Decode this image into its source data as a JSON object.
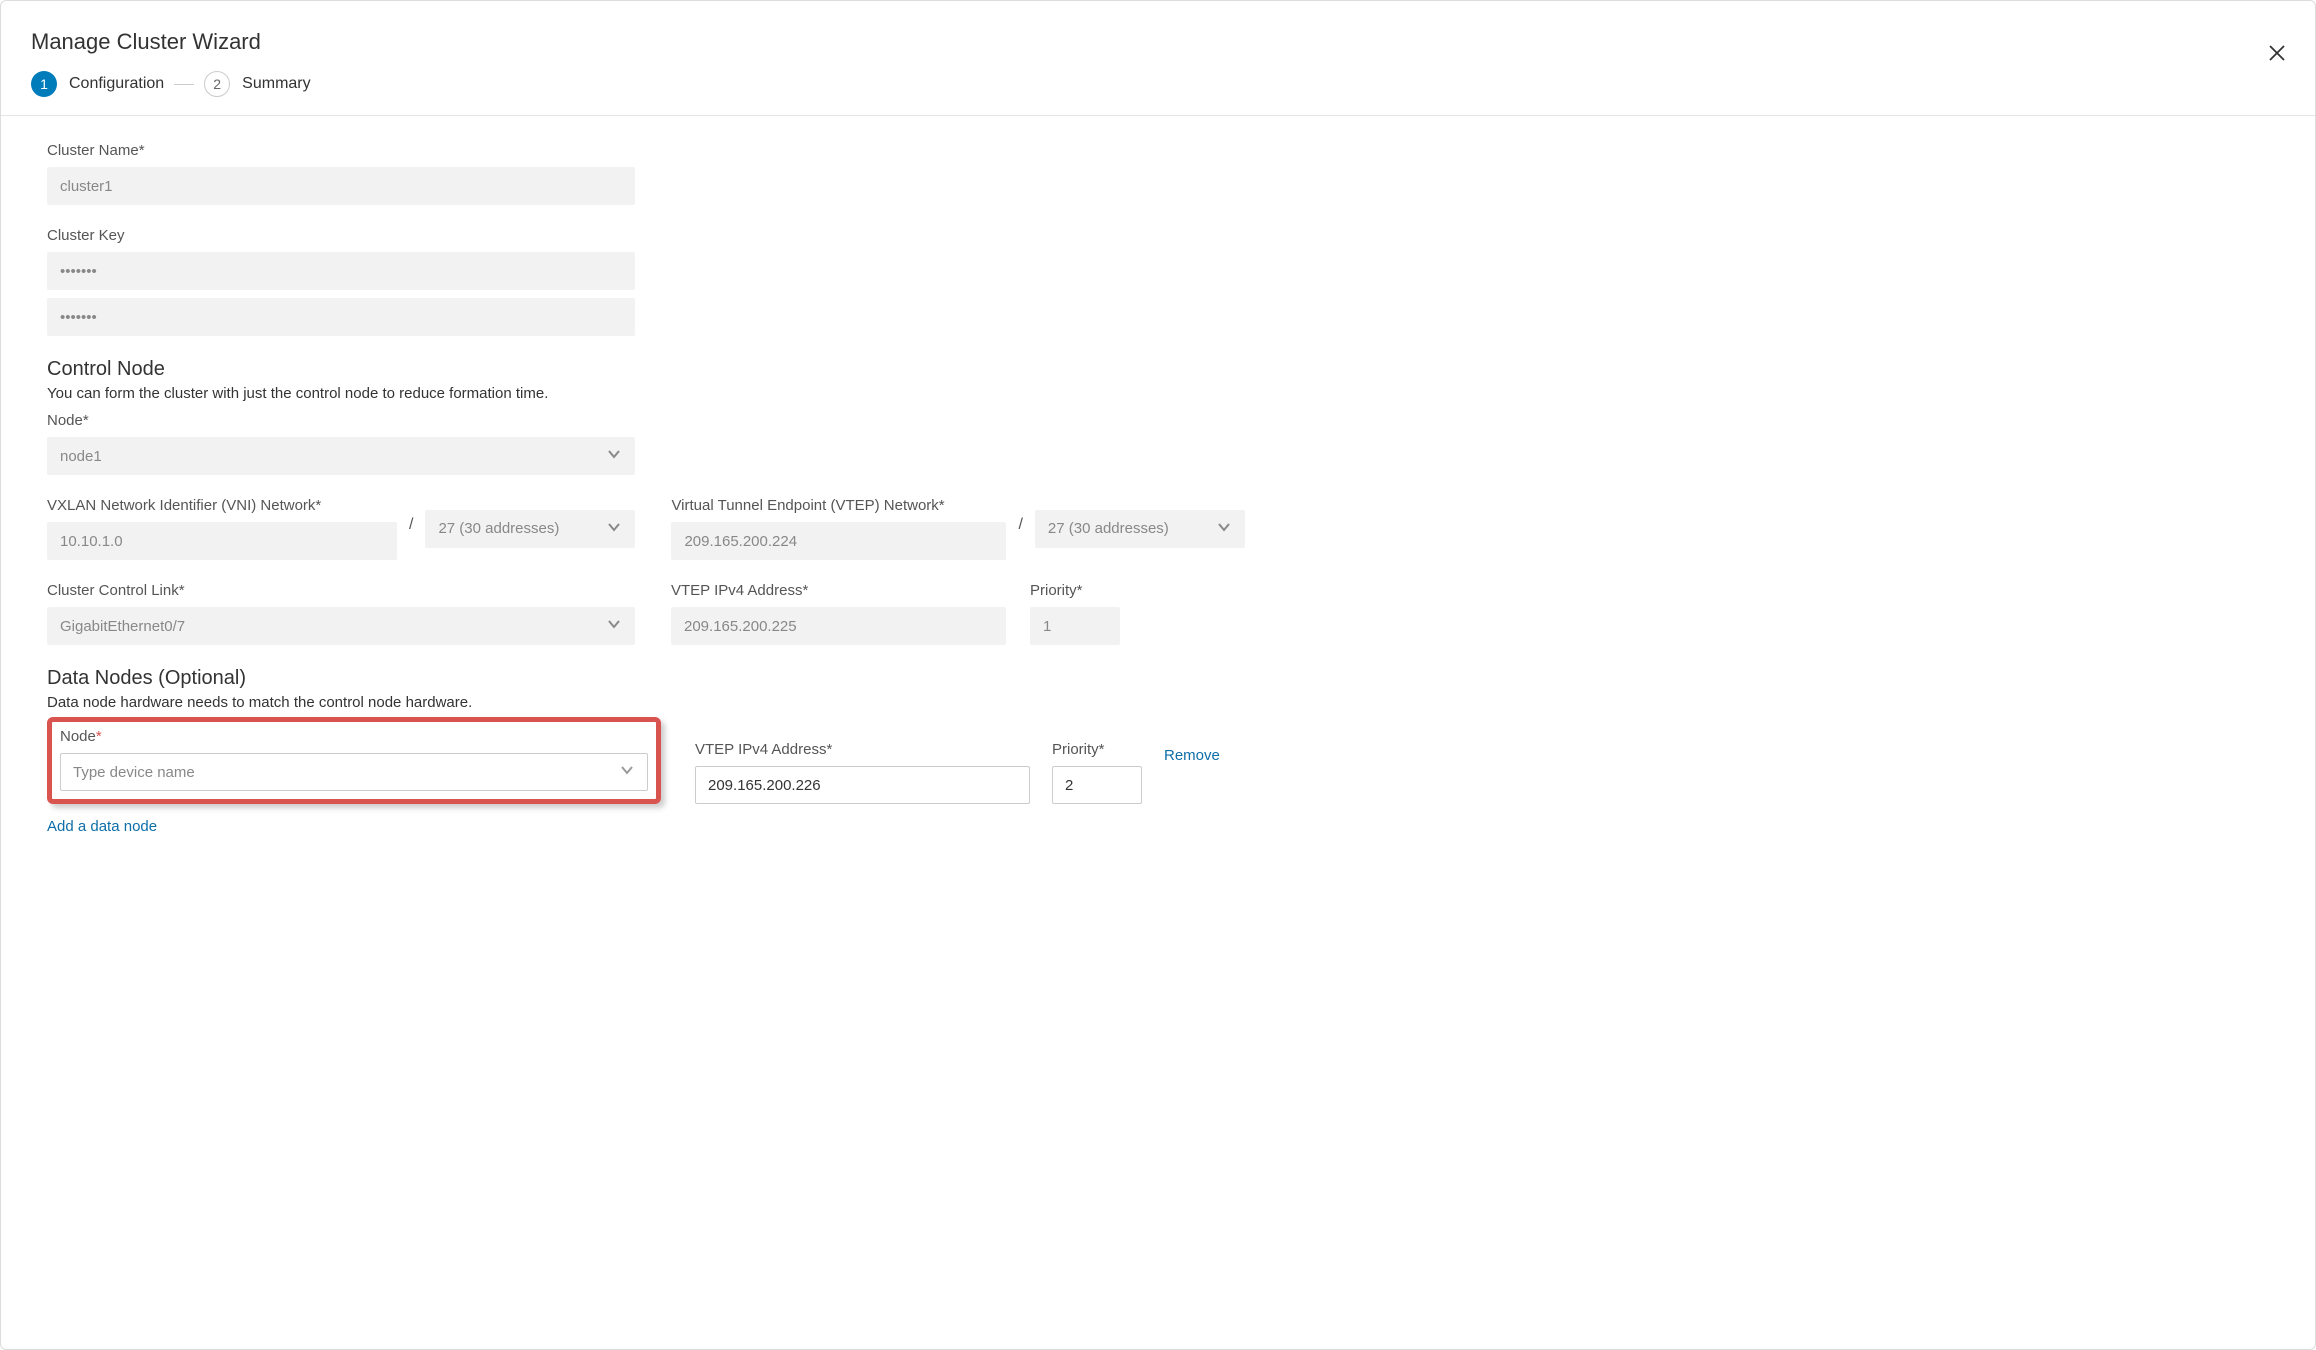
{
  "wizard": {
    "title": "Manage Cluster Wizard",
    "steps": [
      {
        "num": "1",
        "label": "Configuration",
        "active": true
      },
      {
        "num": "2",
        "label": "Summary",
        "active": false
      }
    ]
  },
  "cluster": {
    "name_label": "Cluster Name*",
    "name_value": "cluster1",
    "key_label": "Cluster Key",
    "key_value1": "•••••••",
    "key_value2": "•••••••"
  },
  "control_node": {
    "heading": "Control Node",
    "desc": "You can form the cluster with just the control node to reduce formation time.",
    "node_label": "Node*",
    "node_value": "node1",
    "vni_label": "VXLAN Network Identifier (VNI) Network*",
    "vni_value": "10.10.1.0",
    "vni_mask": "27 (30 addresses)",
    "vtep_net_label": "Virtual Tunnel Endpoint (VTEP) Network*",
    "vtep_net_value": "209.165.200.224",
    "vtep_net_mask": "27 (30 addresses)",
    "ccl_label": "Cluster Control Link*",
    "ccl_value": "GigabitEthernet0/7",
    "vtep_ip_label": "VTEP IPv4 Address*",
    "vtep_ip_value": "209.165.200.225",
    "priority_label": "Priority*",
    "priority_value": "1"
  },
  "data_nodes": {
    "heading": "Data Nodes (Optional)",
    "desc": "Data node hardware needs to match the control node hardware.",
    "node_label": "Node",
    "node_placeholder": "Type device name",
    "vtep_ip_label": "VTEP IPv4 Address*",
    "vtep_ip_value": "209.165.200.226",
    "priority_label": "Priority*",
    "priority_value": "2",
    "remove_label": "Remove",
    "add_label": "Add a data node"
  }
}
